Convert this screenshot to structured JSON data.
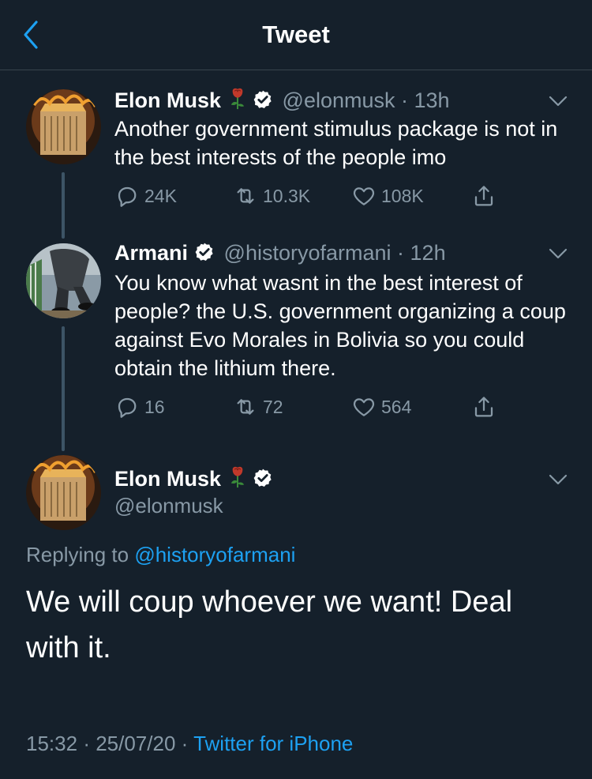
{
  "header": {
    "title": "Tweet",
    "back_icon": "chevron-left-icon"
  },
  "colors": {
    "background": "#15202b",
    "accent": "#1da1f2",
    "muted": "#8899a6",
    "divider": "#38444d",
    "thread_line": "#3d5466",
    "rose": "#c0392b"
  },
  "tweets": [
    {
      "name": "Elon Musk",
      "handle": "@elonmusk",
      "time": "· 13h",
      "text": "Another government stimulus package is not in the best interests of the people imo",
      "replies": "24K",
      "retweets": "10.3K",
      "likes": "108K"
    },
    {
      "name": "Armani",
      "handle": "@historyofarmani",
      "time": "· 12h",
      "text": "You know what wasnt in the best interest of people? the U.S. government organizing a coup against Evo Morales in Bolivia so you could obtain the lithium there.",
      "replies": "16",
      "retweets": "72",
      "likes": "564"
    }
  ],
  "main_tweet": {
    "name": "Elon Musk",
    "handle": "@elonmusk",
    "replying_prefix": "Replying to",
    "replying_to": "@historyofarmani",
    "text": "We will coup whoever we want! Deal with it.",
    "time": "15:32",
    "date": "· 25/07/20 ·",
    "source": "Twitter for iPhone"
  }
}
